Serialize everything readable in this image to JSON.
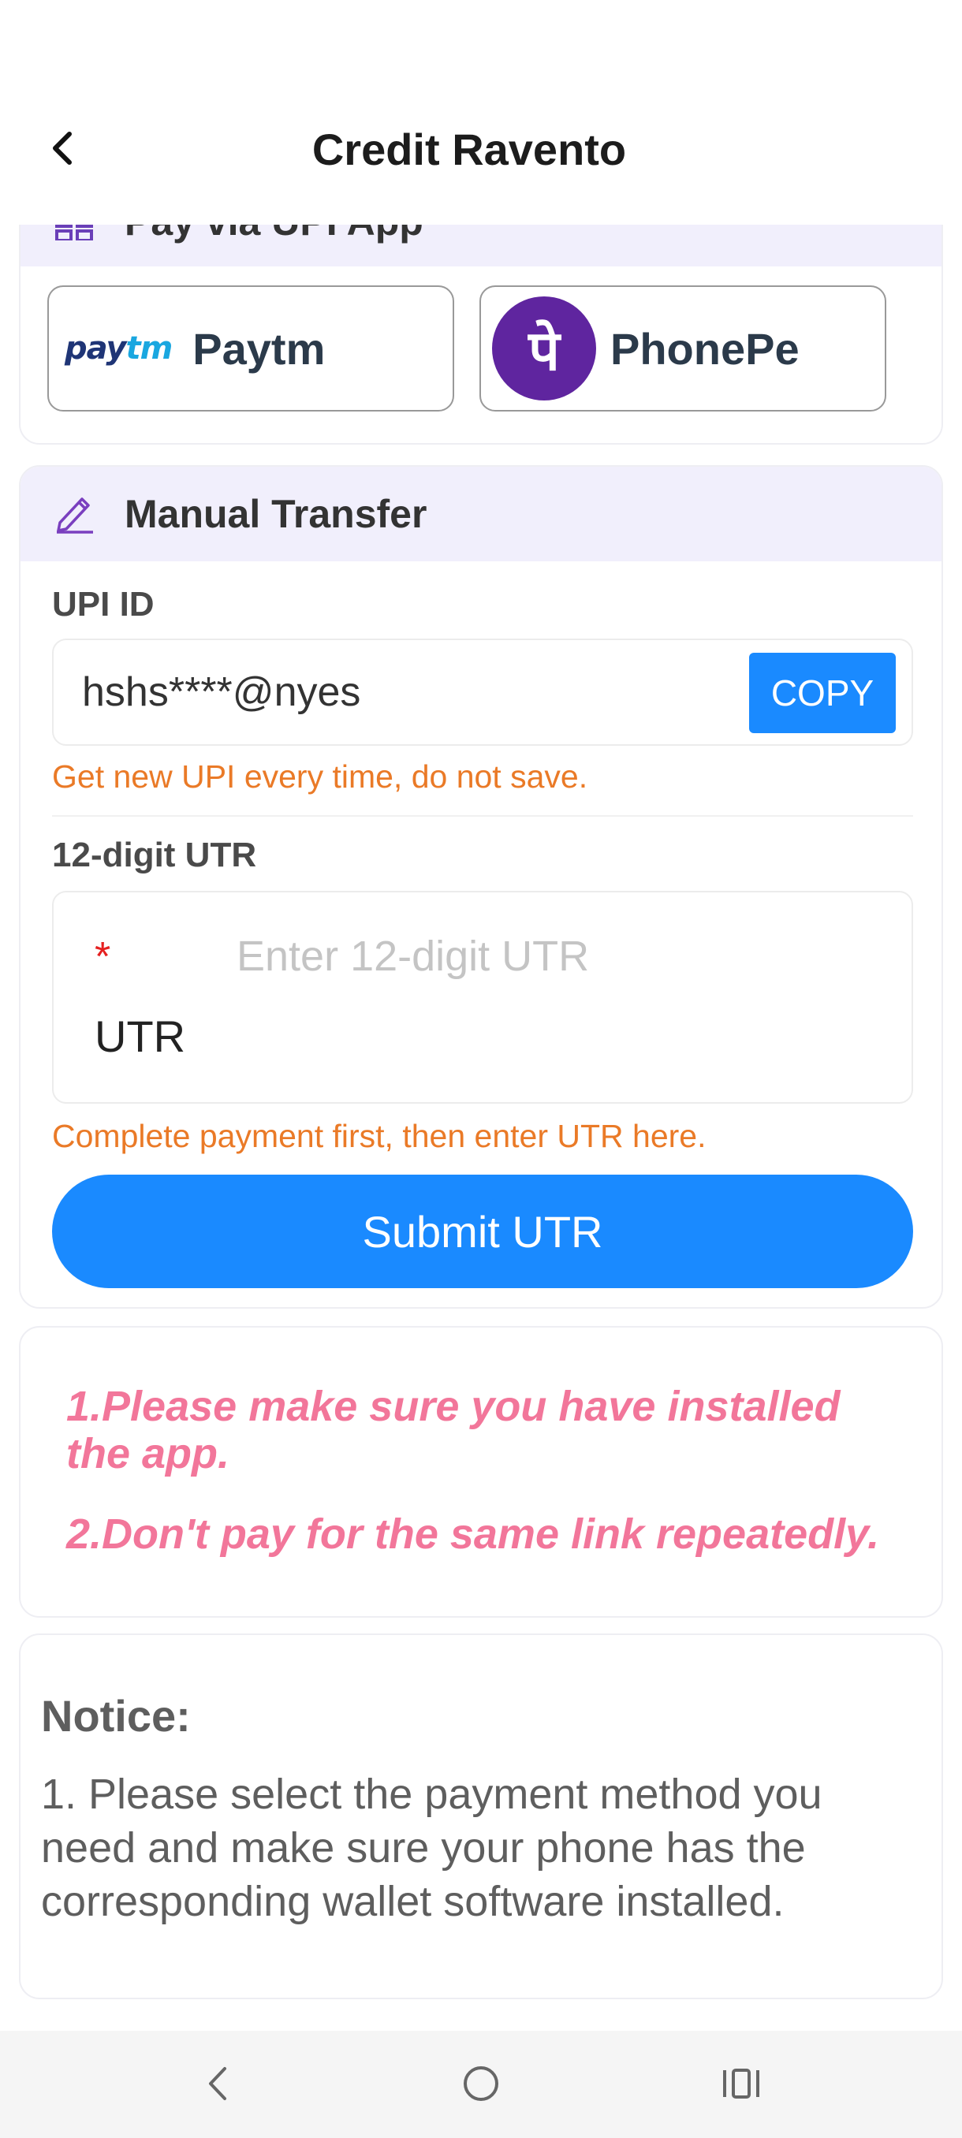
{
  "header": {
    "title": "Credit Ravento"
  },
  "upi_app": {
    "heading": "Pay via UPI App",
    "apps": [
      {
        "name": "Paytm",
        "logo_text": [
          "pay",
          "tm"
        ]
      },
      {
        "name": "PhonePe",
        "logo_glyph": "पे"
      }
    ]
  },
  "manual": {
    "heading": "Manual Transfer",
    "upi_label": "UPI ID",
    "upi_value": "hshs****@nyes",
    "copy_label": "COPY",
    "upi_hint": "Get new UPI every time, do not save.",
    "utr_label": "12-digit UTR",
    "utr_required": "*",
    "utr_placeholder": "Enter 12-digit UTR",
    "utr_field_label": "UTR",
    "utr_hint": "Complete payment first, then enter UTR here.",
    "submit_label": "Submit UTR"
  },
  "warnings": [
    "1.Please make sure you have installed the app.",
    "2.Don't pay for the same link repeatedly."
  ],
  "notice": {
    "title": "Notice:",
    "text": "1. Please select the payment method you need and make sure your phone has the corresponding wallet software installed."
  },
  "colors": {
    "accent": "#1a8aff",
    "hint": "#ea7a27",
    "warning": "#f2769a",
    "header_band": "#f1effc",
    "phonepe": "#5f259f"
  },
  "nav": {
    "icons": [
      "back-nav-icon",
      "home-nav-icon",
      "recents-nav-icon"
    ]
  }
}
